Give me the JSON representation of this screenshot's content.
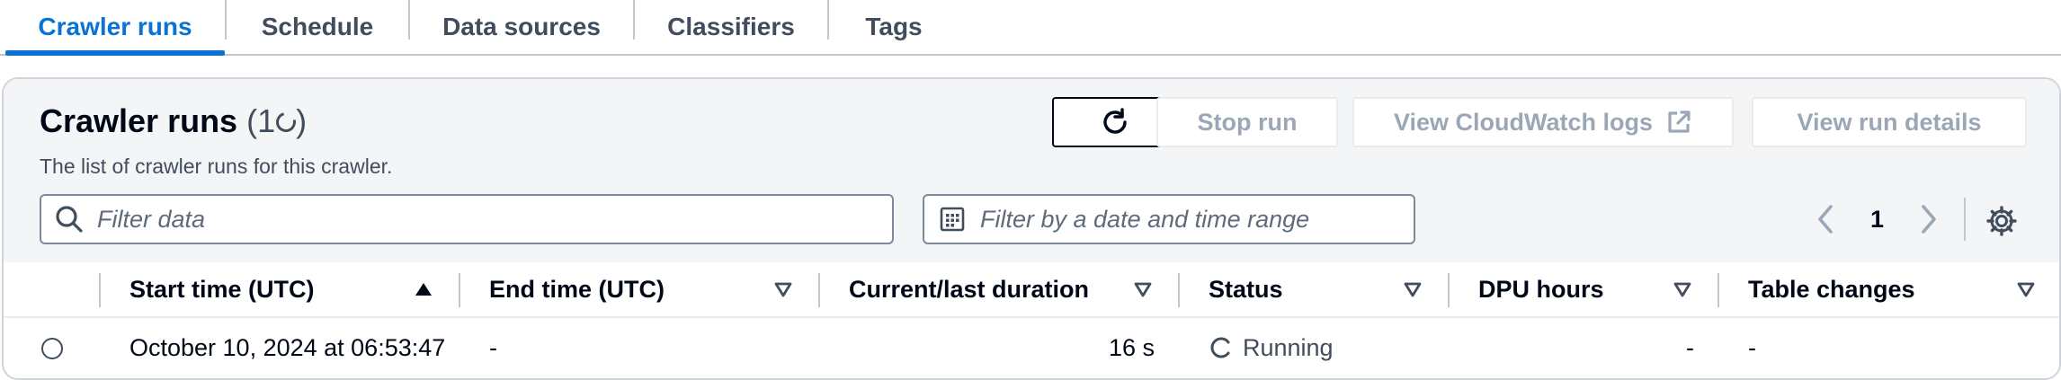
{
  "tabs": [
    {
      "label": "Crawler runs",
      "active": true
    },
    {
      "label": "Schedule",
      "active": false
    },
    {
      "label": "Data sources",
      "active": false
    },
    {
      "label": "Classifiers",
      "active": false
    },
    {
      "label": "Tags",
      "active": false
    }
  ],
  "panel": {
    "title": "Crawler runs",
    "count_prefix": "(1",
    "count_suffix": ")",
    "description": "The list of crawler runs for this crawler."
  },
  "actions": {
    "stop_run": "Stop run",
    "view_logs": "View CloudWatch logs",
    "view_details": "View run details"
  },
  "filters": {
    "text_placeholder": "Filter data",
    "date_placeholder": "Filter by a date and time range"
  },
  "pagination": {
    "current_page": "1"
  },
  "table": {
    "columns": [
      {
        "label": "Start time (UTC)",
        "sort": "ascending"
      },
      {
        "label": "End time (UTC)",
        "sort": "none"
      },
      {
        "label": "Current/last duration",
        "sort": "none"
      },
      {
        "label": "Status",
        "sort": "none"
      },
      {
        "label": "DPU hours",
        "sort": "none"
      },
      {
        "label": "Table changes",
        "sort": "none"
      }
    ],
    "rows": [
      {
        "start_time": "October 10, 2024 at 06:53:47",
        "end_time": "-",
        "duration": "16 s",
        "status": "Running",
        "dpu_hours": "-",
        "table_changes": "-"
      }
    ]
  },
  "colors": {
    "accent": "#0972d3",
    "text": "#000716",
    "secondary_text": "#414d5c",
    "disabled": "#9ba7b6",
    "header_bg": "#f4f5f6"
  },
  "icons": [
    "refresh-icon",
    "external-link-icon",
    "search-icon",
    "calendar-icon",
    "chevron-left-icon",
    "chevron-right-icon",
    "settings-gear-icon",
    "sort-ascending-icon",
    "sort-descending-icon",
    "status-spinner-icon"
  ]
}
